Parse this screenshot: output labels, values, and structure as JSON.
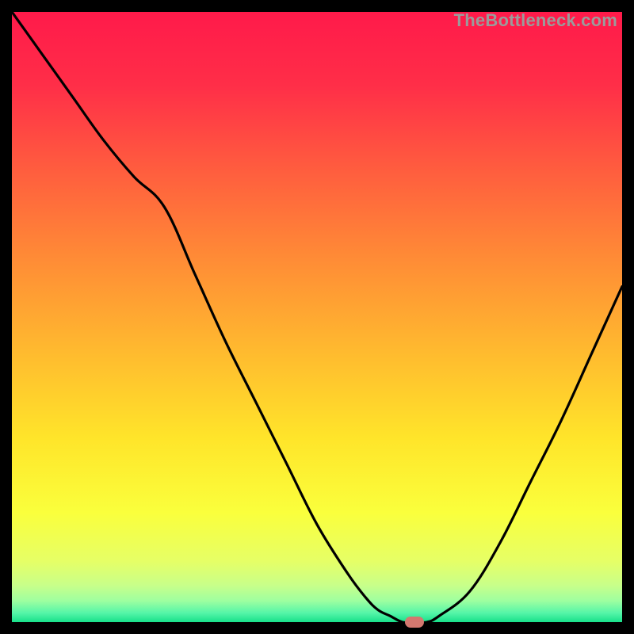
{
  "watermark": "TheBottleneck.com",
  "chart_data": {
    "type": "line",
    "title": "",
    "xlabel": "",
    "ylabel": "",
    "xlim": [
      0,
      100
    ],
    "ylim": [
      0,
      100
    ],
    "series": [
      {
        "name": "bottleneck-curve",
        "x": [
          0,
          5,
          10,
          15,
          20,
          25,
          30,
          35,
          40,
          45,
          50,
          55,
          58,
          60,
          62,
          64,
          66,
          68,
          70,
          75,
          80,
          85,
          90,
          95,
          100
        ],
        "y": [
          100,
          93,
          86,
          79,
          73,
          68,
          57,
          46,
          36,
          26,
          16,
          8,
          4,
          2,
          1,
          0,
          0,
          0,
          1,
          5,
          13,
          23,
          33,
          44,
          55
        ]
      }
    ],
    "marker": {
      "x": 66,
      "y": 0
    },
    "background_gradient": {
      "stops": [
        {
          "pos": 0.0,
          "color": "#ff1a4a"
        },
        {
          "pos": 0.12,
          "color": "#ff2e48"
        },
        {
          "pos": 0.25,
          "color": "#ff5a3f"
        },
        {
          "pos": 0.4,
          "color": "#ff8a36"
        },
        {
          "pos": 0.55,
          "color": "#ffb82f"
        },
        {
          "pos": 0.7,
          "color": "#ffe52a"
        },
        {
          "pos": 0.82,
          "color": "#faff3c"
        },
        {
          "pos": 0.9,
          "color": "#e6ff66"
        },
        {
          "pos": 0.94,
          "color": "#c8ff8a"
        },
        {
          "pos": 0.965,
          "color": "#9effa0"
        },
        {
          "pos": 0.985,
          "color": "#55f5a8"
        },
        {
          "pos": 1.0,
          "color": "#18e08a"
        }
      ]
    }
  }
}
